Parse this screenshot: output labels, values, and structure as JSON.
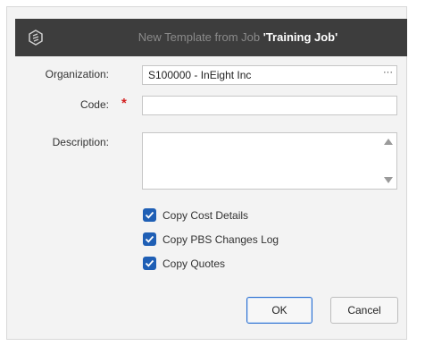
{
  "dialog": {
    "title_prefix": "New Template from Job",
    "title_job": "'Training Job'"
  },
  "form": {
    "organization_label": "Organization:",
    "organization_value": "S100000 - InEight Inc",
    "organization_picker": "···",
    "code_label": "Code:",
    "code_required_marker": "*",
    "code_value": "",
    "description_label": "Description:",
    "description_value": ""
  },
  "options": [
    {
      "label": "Copy Cost Details",
      "checked": true
    },
    {
      "label": "Copy PBS Changes Log",
      "checked": true
    },
    {
      "label": "Copy Quotes",
      "checked": true
    }
  ],
  "buttons": {
    "ok": "OK",
    "cancel": "Cancel"
  },
  "colors": {
    "titlebar": "#3d3d3d",
    "checkbox": "#1f5fb5",
    "required": "#d32020"
  }
}
